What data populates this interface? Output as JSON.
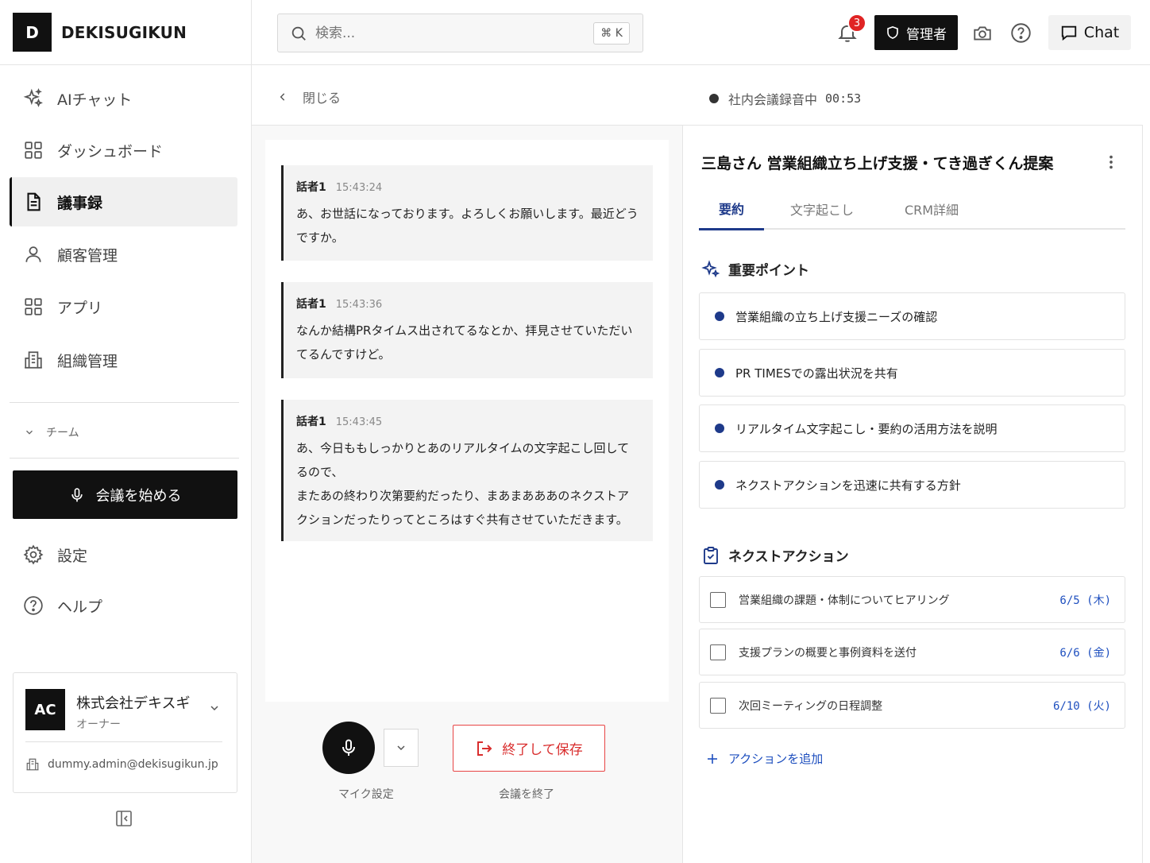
{
  "brand": {
    "logo": "D",
    "name": "DEKISUGIKUN"
  },
  "nav": [
    {
      "label": "AIチャット",
      "icon": "sparkles-icon"
    },
    {
      "label": "ダッシュボード",
      "icon": "dashboard-icon"
    },
    {
      "label": "議事録",
      "icon": "document-icon",
      "active": true
    },
    {
      "label": "顧客管理",
      "icon": "user-icon"
    },
    {
      "label": "アプリ",
      "icon": "apps-icon"
    },
    {
      "label": "組織管理",
      "icon": "building-icon"
    }
  ],
  "team": {
    "label": "チーム"
  },
  "start_meeting": {
    "label": "会議を始める"
  },
  "settings": {
    "label": "設定"
  },
  "help": {
    "label": "ヘルプ"
  },
  "org": {
    "avatar": "AC",
    "name": "株式会社デキスギ",
    "role": "オーナー",
    "email": "dummy.admin@dekisugikun.jp"
  },
  "header": {
    "search_placeholder": "検索...",
    "shortcut": "⌘ K",
    "notification_count": "3",
    "admin_label": "管理者",
    "chat_label": "Chat"
  },
  "subheader": {
    "close_label": "閉じる",
    "recording_label": "社内会議録音中",
    "recording_time": "00:53"
  },
  "transcript": [
    {
      "speaker": "話者1",
      "time": "15:43:24",
      "text": "あ、お世話になっております。よろしくお願いします。最近どうですか。"
    },
    {
      "speaker": "話者1",
      "time": "15:43:36",
      "text": "なんか結構PRタイムス出されてるなとか、拝見させていただいてるんですけど。"
    },
    {
      "speaker": "話者1",
      "time": "15:43:45",
      "text": "あ、今日ももしっかりとあのリアルタイムの文字起こし回してるので、\nまたあの終わり次第要約だったり、まあまあああのネクストアクションだったりってところはすぐ共有させていただきます。"
    }
  ],
  "controls": {
    "mic_label": "マイク設定",
    "end_button": "終了して保存",
    "end_label": "会議を終了"
  },
  "meeting": {
    "title": "三島さん 営業組織立ち上げ支援・てき過ぎくん提案",
    "tabs": [
      "要約",
      "文字起こし",
      "CRM詳細"
    ],
    "active_tab": "要約",
    "key_points_title": "重要ポイント",
    "key_points": [
      "営業組織の立ち上げ支援ニーズの確認",
      "PR TIMESでの露出状況を共有",
      "リアルタイム文字起こし・要約の活用方法を説明",
      "ネクストアクションを迅速に共有する方針"
    ],
    "next_actions_title": "ネクストアクション",
    "next_actions": [
      {
        "text": "営業組織の課題・体制についてヒアリング",
        "date": "6/5 (木)"
      },
      {
        "text": "支援プランの概要と事例資料を送付",
        "date": "6/6 (金)"
      },
      {
        "text": "次回ミーティングの日程調整",
        "date": "6/10 (火)"
      }
    ],
    "add_action_label": "アクションを追加"
  },
  "colors": {
    "accent": "#1e3a8a",
    "link": "#1e4fbf",
    "danger": "#d92d2d",
    "badge": "#e02424"
  }
}
